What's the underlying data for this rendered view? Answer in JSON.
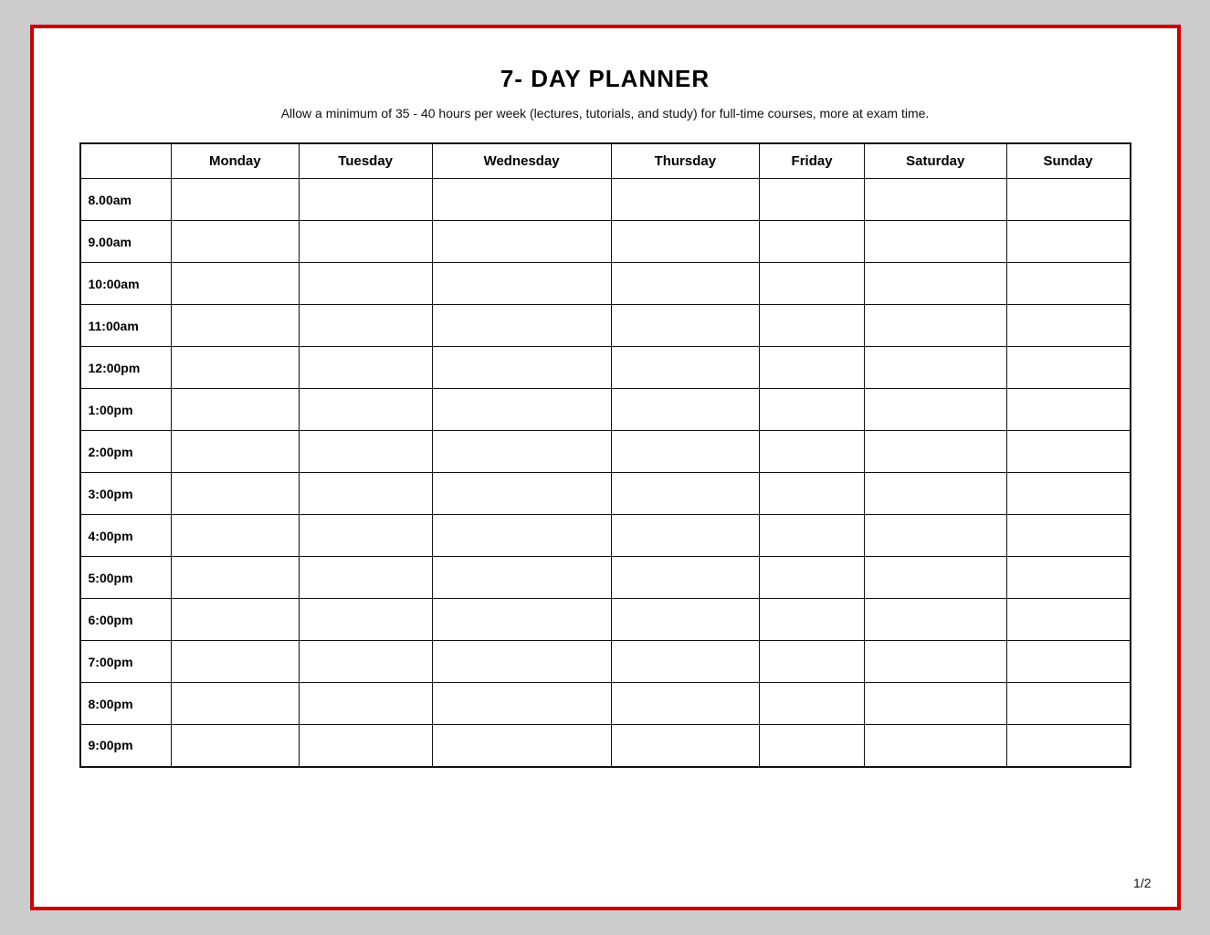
{
  "title": "7- DAY PLANNER",
  "subtitle": "Allow a minimum of 35 - 40 hours per week (lectures, tutorials, and study) for full-time courses, more at exam time.",
  "page_number": "1/2",
  "columns": {
    "time_header": "",
    "days": [
      "Monday",
      "Tuesday",
      "Wednesday",
      "Thursday",
      "Friday",
      "Saturday",
      "Sunday"
    ]
  },
  "time_slots": [
    "8.00am",
    "9.00am",
    "10:00am",
    "11:00am",
    "12:00pm",
    "1:00pm",
    "2:00pm",
    "3:00pm",
    "4:00pm",
    "5:00pm",
    "6:00pm",
    "7:00pm",
    "8:00pm",
    "9:00pm"
  ]
}
